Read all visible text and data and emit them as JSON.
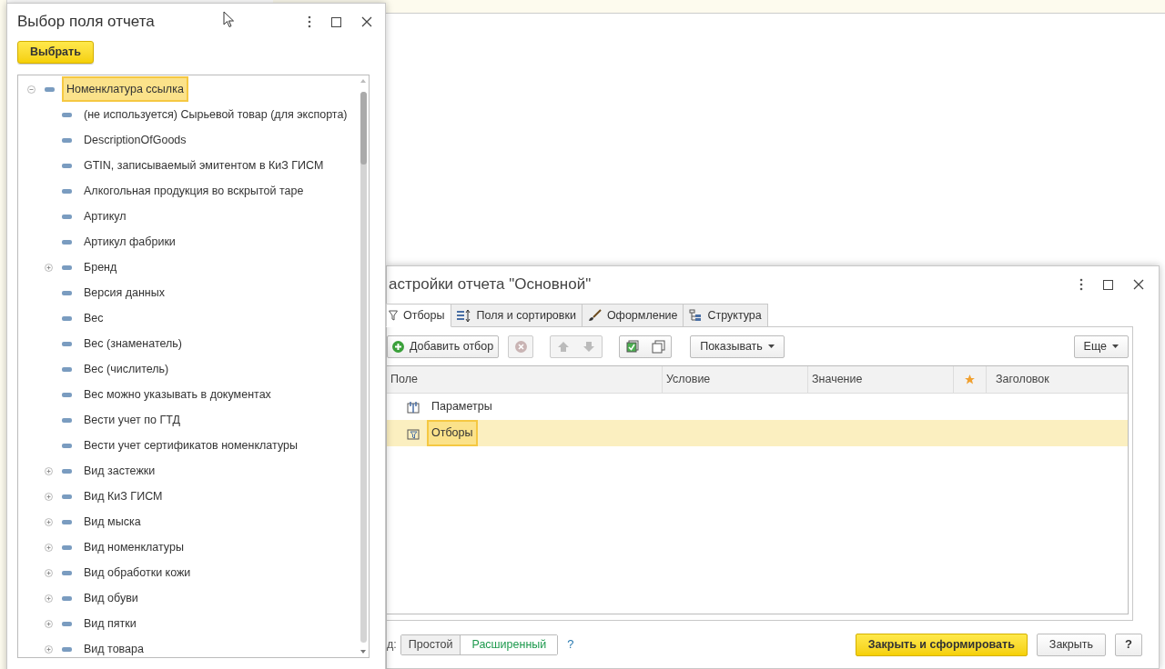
{
  "field_dialog": {
    "title": "Выбор поля отчета",
    "select_button": "Выбрать",
    "tree": [
      {
        "label": "Номенклатура ссылка",
        "kind": "group",
        "expanded": true,
        "selected": true,
        "children": [
          {
            "label": "(не используется) Сырьевой товар (для экспорта)",
            "kind": "field",
            "selected": false
          },
          {
            "label": "DescriptionOfGoods",
            "kind": "field",
            "selected": false
          },
          {
            "label": "GTIN, записываемый эмитентом в КиЗ ГИСМ",
            "kind": "field",
            "selected": false
          },
          {
            "label": "Алкогольная продукция во вскрытой таре",
            "kind": "field",
            "selected": false
          },
          {
            "label": "Артикул",
            "kind": "field",
            "selected": false
          },
          {
            "label": "Артикул фабрики",
            "kind": "field",
            "selected": false
          },
          {
            "label": "Бренд",
            "kind": "group",
            "expanded": false,
            "selected": false
          },
          {
            "label": "Версия данных",
            "kind": "field",
            "selected": false
          },
          {
            "label": "Вес",
            "kind": "field",
            "selected": false
          },
          {
            "label": "Вес (знаменатель)",
            "kind": "field",
            "selected": false
          },
          {
            "label": "Вес (числитель)",
            "kind": "field",
            "selected": false
          },
          {
            "label": "Вес можно указывать в документах",
            "kind": "field",
            "selected": false
          },
          {
            "label": "Вести учет по ГТД",
            "kind": "field",
            "selected": false
          },
          {
            "label": "Вести учет сертификатов номенклатуры",
            "kind": "field",
            "selected": false
          },
          {
            "label": "Вид застежки",
            "kind": "group",
            "expanded": false,
            "selected": false
          },
          {
            "label": "Вид КиЗ ГИСМ",
            "kind": "group",
            "expanded": false,
            "selected": false
          },
          {
            "label": "Вид мыска",
            "kind": "group",
            "expanded": false,
            "selected": false
          },
          {
            "label": "Вид номенклатуры",
            "kind": "group",
            "expanded": false,
            "selected": false
          },
          {
            "label": "Вид обработки кожи",
            "kind": "group",
            "expanded": false,
            "selected": false
          },
          {
            "label": "Вид обуви",
            "kind": "group",
            "expanded": false,
            "selected": false
          },
          {
            "label": "Вид пятки",
            "kind": "group",
            "expanded": false,
            "selected": false
          },
          {
            "label": "Вид товара",
            "kind": "group",
            "expanded": false,
            "selected": false
          }
        ]
      }
    ]
  },
  "settings_dialog": {
    "title": "астройки отчета \"Основной\"",
    "tabs": [
      {
        "label": "Отборы",
        "selected": true
      },
      {
        "label": "Поля и сортировки",
        "selected": false
      },
      {
        "label": "Оформление",
        "selected": false
      },
      {
        "label": "Структура",
        "selected": false
      }
    ],
    "toolbar": {
      "add_button": "Добавить отбор",
      "show_button": "Показывать",
      "more_button": "Еще"
    },
    "table": {
      "columns": [
        "Поле",
        "Условие",
        "Значение",
        "Заголовок"
      ],
      "rows": [
        {
          "label": "Параметры",
          "kind": "params",
          "selected": false
        },
        {
          "label": "Отборы",
          "kind": "filters",
          "selected": true
        }
      ]
    },
    "mode_label": "д:",
    "modes": [
      {
        "label": "Простой",
        "selected": false
      },
      {
        "label": "Расширенный",
        "selected": true
      }
    ],
    "mode_help": "?",
    "footer_buttons": {
      "primary": "Закрыть и сформировать",
      "close": "Закрыть",
      "help": "?"
    }
  }
}
